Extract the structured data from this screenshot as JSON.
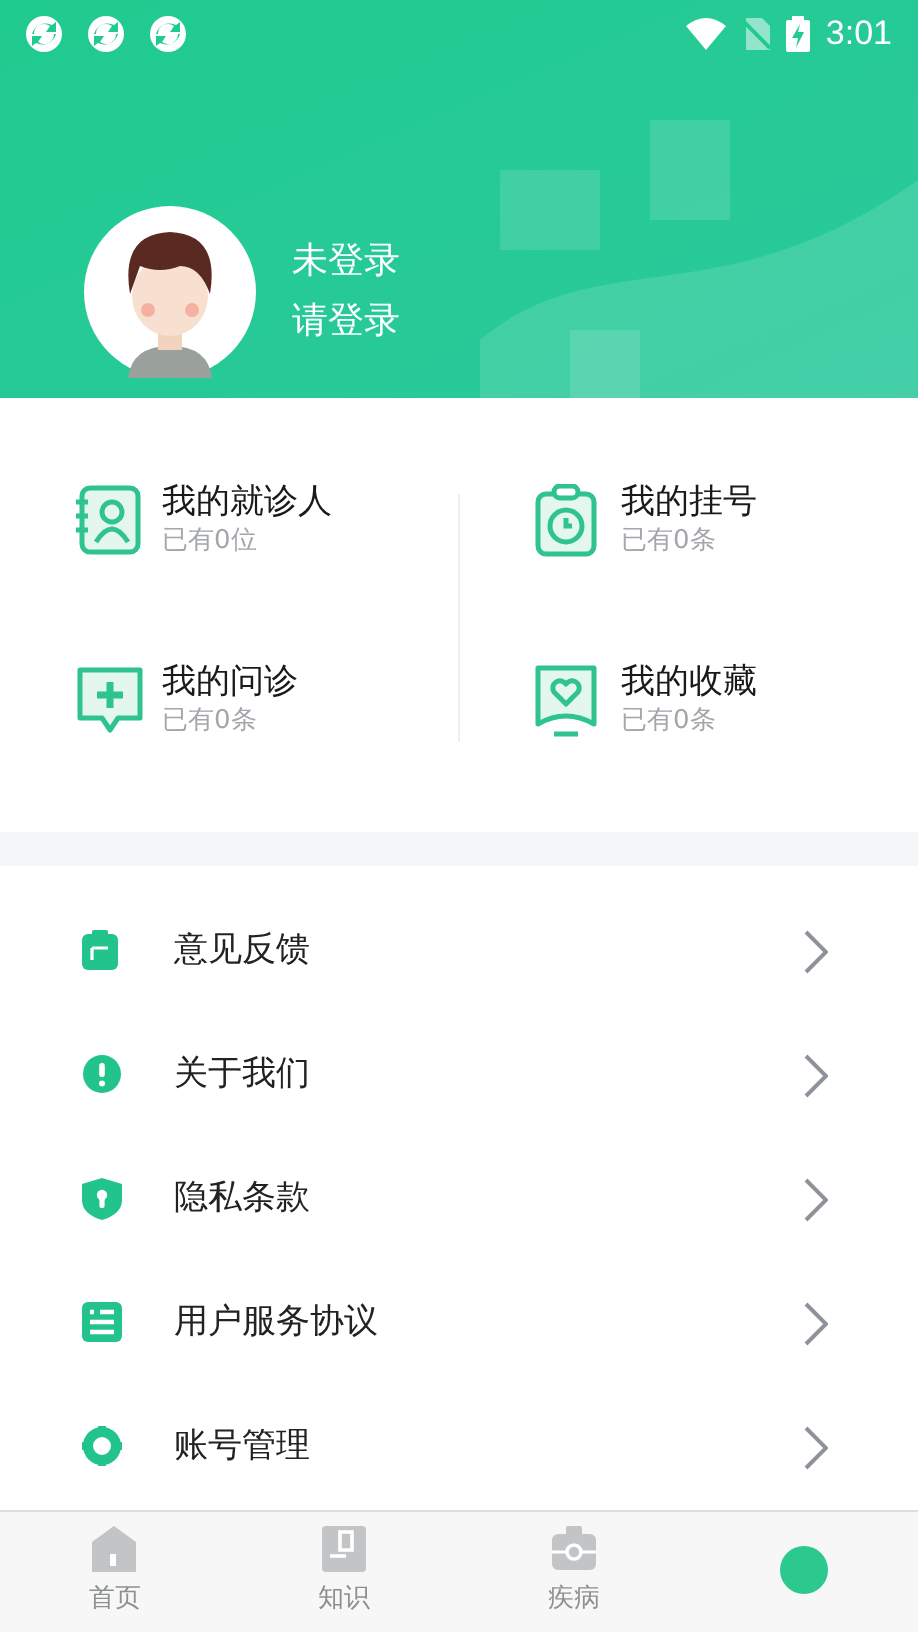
{
  "status_bar": {
    "time": "3:01"
  },
  "profile": {
    "name": "未登录",
    "hint": "请登录"
  },
  "shortcuts": [
    {
      "kind": "patient",
      "title": "我的就诊人",
      "count": "已有0位"
    },
    {
      "kind": "registration",
      "title": "我的挂号",
      "count": "已有0条"
    },
    {
      "kind": "consult",
      "title": "我的问诊",
      "count": "已有0条"
    },
    {
      "kind": "favorite",
      "title": "我的收藏",
      "count": "已有0条"
    }
  ],
  "menu": [
    {
      "kind": "feedback",
      "label": "意见反馈"
    },
    {
      "kind": "about",
      "label": "关于我们"
    },
    {
      "kind": "privacy",
      "label": "隐私条款"
    },
    {
      "kind": "agreement",
      "label": "用户服务协议"
    },
    {
      "kind": "account",
      "label": "账号管理"
    }
  ],
  "tabs": [
    {
      "kind": "home",
      "label": "首页",
      "selected": false
    },
    {
      "kind": "knowledge",
      "label": "知识",
      "selected": false
    },
    {
      "kind": "disease",
      "label": "疾病",
      "selected": false
    },
    {
      "kind": "me",
      "selected": true
    }
  ]
}
